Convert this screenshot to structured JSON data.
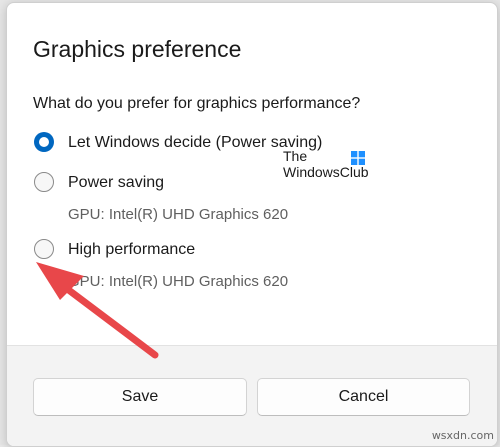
{
  "dialog": {
    "title": "Graphics preference",
    "question": "What do you prefer for graphics performance?",
    "options": [
      {
        "label": "Let Windows decide (Power saving)",
        "selected": true,
        "gpu": ""
      },
      {
        "label": "Power saving",
        "selected": false,
        "gpu": "GPU: Intel(R) UHD Graphics 620"
      },
      {
        "label": "High performance",
        "selected": false,
        "gpu": "GPU: Intel(R) UHD Graphics 620"
      }
    ],
    "buttons": {
      "save": "Save",
      "cancel": "Cancel"
    }
  },
  "watermark": {
    "logo_line1": "The",
    "logo_line2": "WindowsClub",
    "site": "wsxdn.com"
  },
  "colors": {
    "accent": "#0067c0",
    "arrow": "#e8474a",
    "logo_blue": "#1e90ff"
  }
}
